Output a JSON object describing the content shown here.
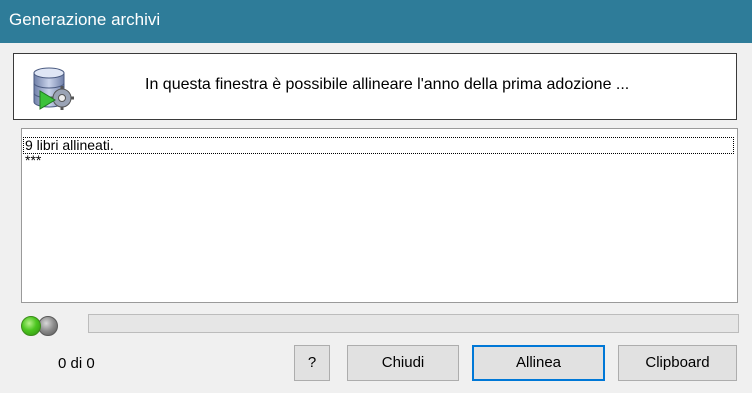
{
  "window": {
    "title": "Generazione archivi"
  },
  "header": {
    "icon": "database-gear-play-icon",
    "description": "In questa finestra è possibile allineare l'anno della prima adozione ..."
  },
  "log": {
    "lines": [
      "9 libri allineati.",
      "***"
    ]
  },
  "status": {
    "indicators": [
      {
        "name": "green-status-light",
        "color": "#4cc620"
      },
      {
        "name": "gray-status-light",
        "color": "#8a8a8a"
      }
    ],
    "progress_fraction": 0,
    "counter": "0 di 0"
  },
  "buttons": {
    "help": "?",
    "close": "Chiudi",
    "align": "Allinea",
    "clipboard": "Clipboard"
  },
  "colors": {
    "titlebar": "#2e7c99",
    "progress_fill": "#06b025"
  }
}
